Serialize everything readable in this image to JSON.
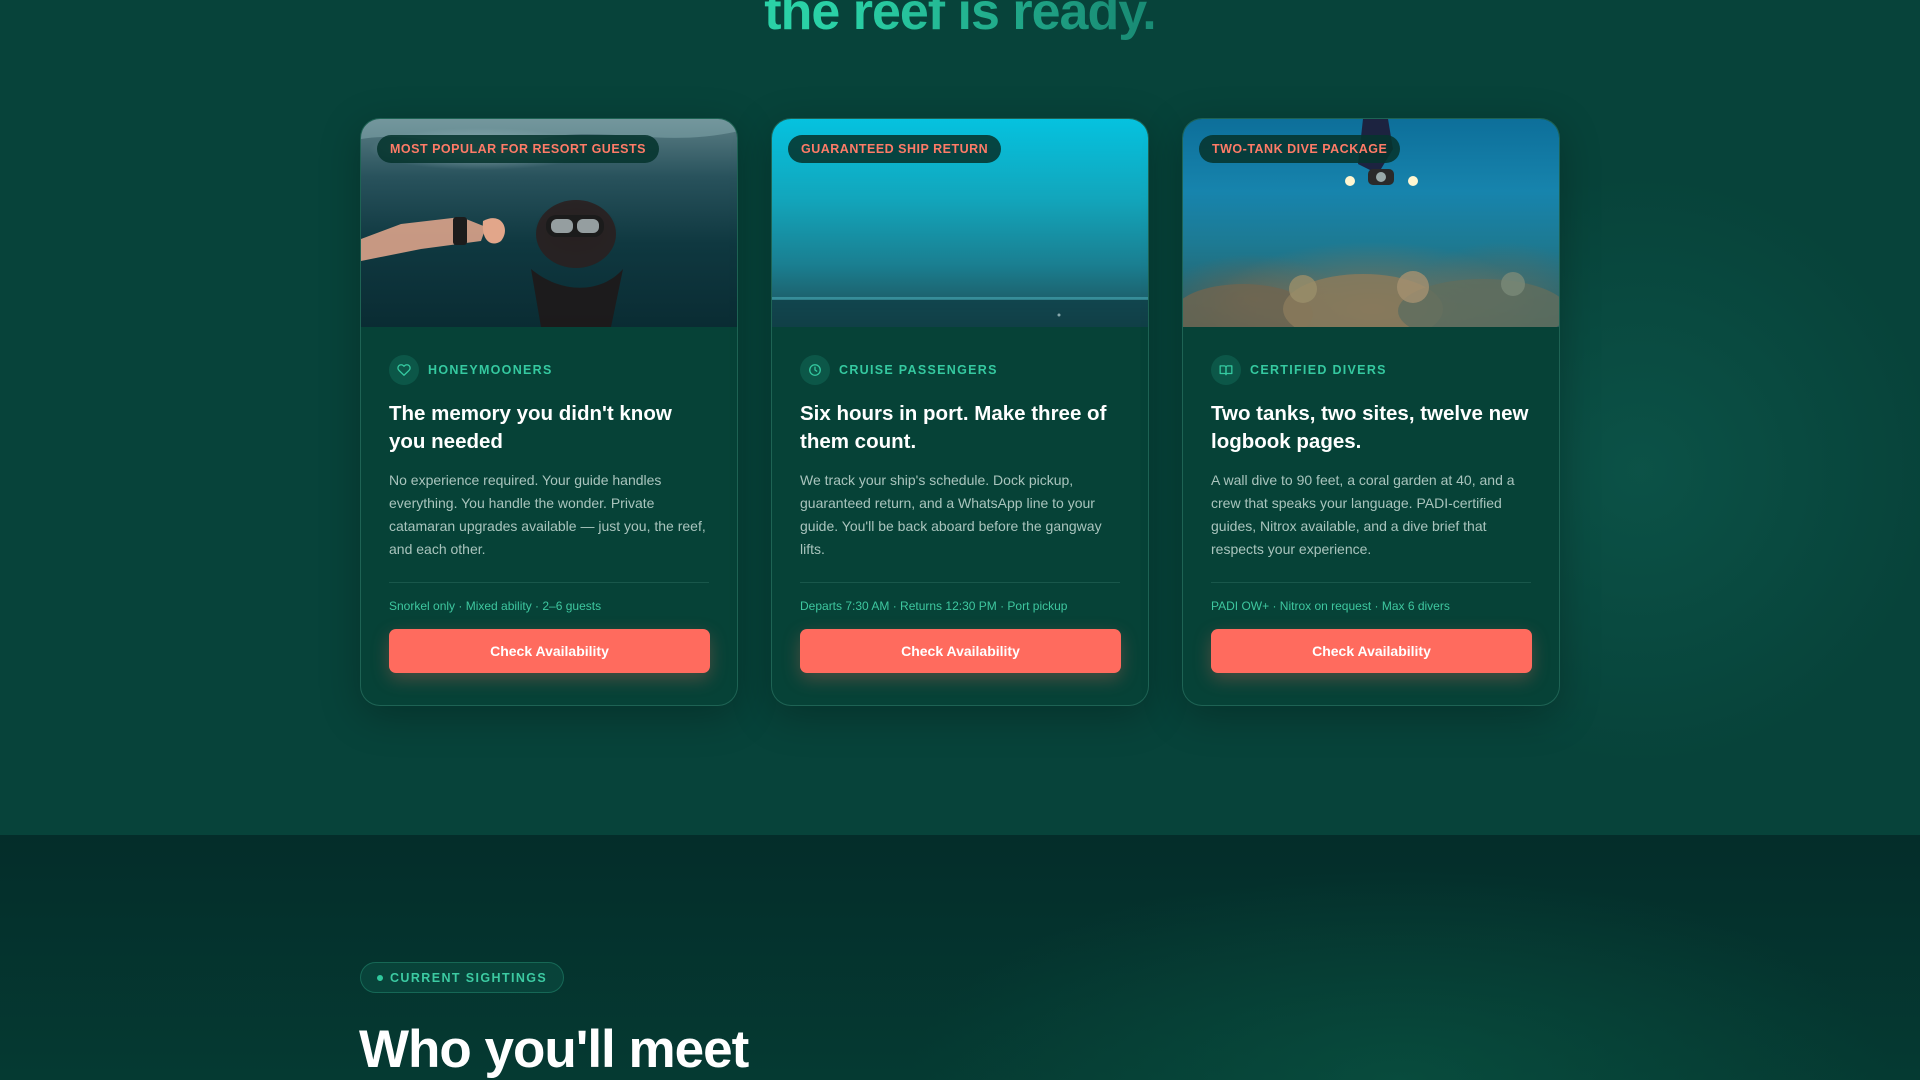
{
  "hero": {
    "headline": "the reef is ready."
  },
  "cards": [
    {
      "badge": "MOST POPULAR FOR RESORT GUESTS",
      "icon": "heart-icon",
      "audience": "HONEYMOONERS",
      "title": "The memory you didn't know you needed",
      "description": "No experience required. Your guide handles everything. You handle the wonder. Private catamaran upgrades available — just you, the reef, and each other.",
      "meta": "Snorkel only · Mixed ability · 2–6 guests",
      "cta": "Check Availability"
    },
    {
      "badge": "GUARANTEED SHIP RETURN",
      "icon": "clock-icon",
      "audience": "CRUISE PASSENGERS",
      "title": "Six hours in port. Make three of them count.",
      "description": "We track your ship's schedule. Dock pickup, guaranteed return, and a WhatsApp line to your guide. You'll be back aboard before the gangway lifts.",
      "meta": "Departs 7:30 AM · Returns 12:30 PM · Port pickup",
      "cta": "Check Availability"
    },
    {
      "badge": "TWO-TANK DIVE PACKAGE",
      "icon": "book-icon",
      "audience": "CERTIFIED DIVERS",
      "title": "Two tanks, two sites, twelve new logbook pages.",
      "description": "A wall dive to 90 feet, a coral garden at 40, and a crew that speaks your language. PADI-certified guides, Nitrox available, and a dive brief that respects your experience.",
      "meta": "PADI OW+ · Nitrox on request · Max 6 divers",
      "cta": "Check Availability"
    }
  ],
  "sightings": {
    "pill": "CURRENT SIGHTINGS",
    "title": "Who you'll meet"
  },
  "colors": {
    "background": "#07433a",
    "accent": "#2ad1a6",
    "cta": "#ff6b5e",
    "badge_text": "#ff7b67"
  }
}
